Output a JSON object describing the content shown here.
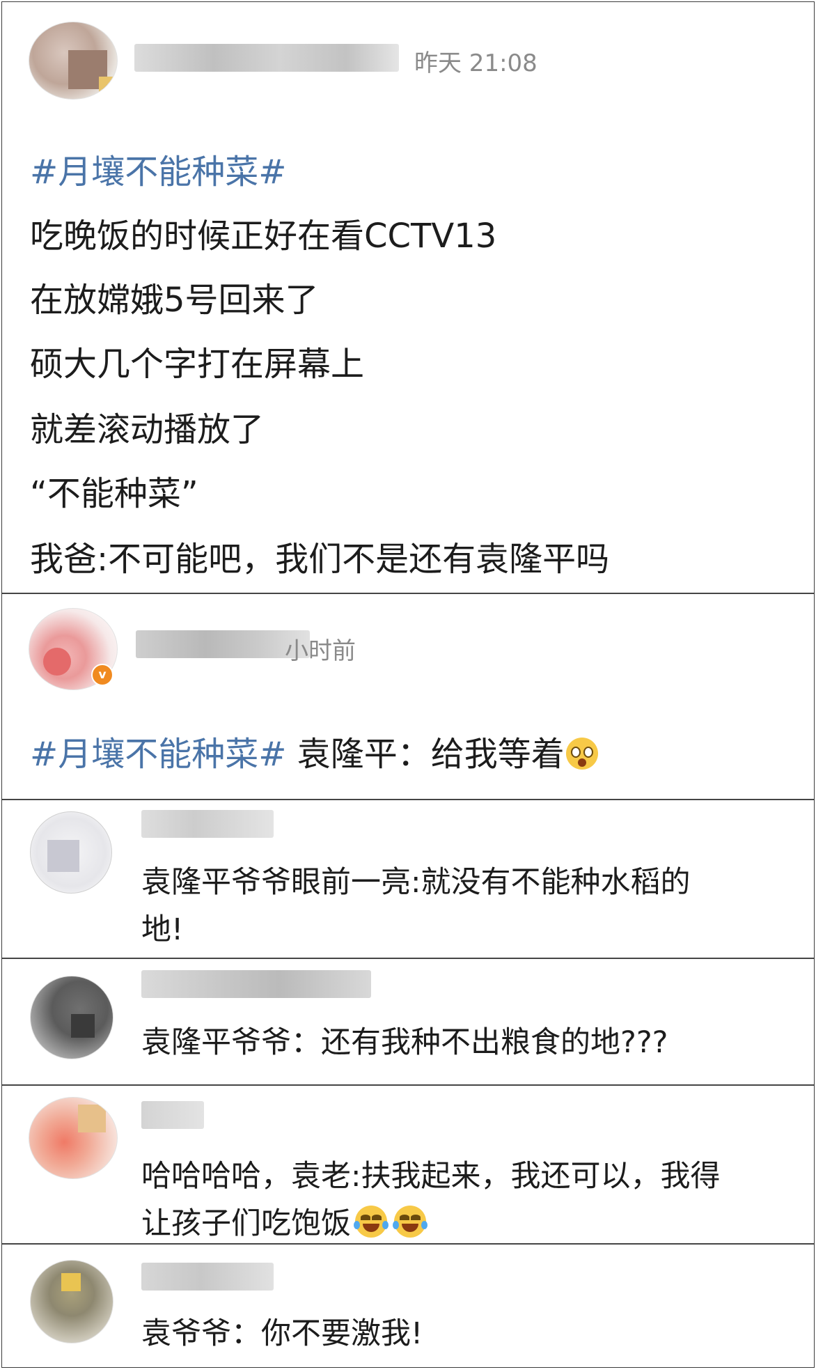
{
  "posts": [
    {
      "time": "昨天 21:08",
      "topic": "#月壤不能种菜#",
      "lines": [
        "吃晚饭的时候正好在看CCTV13",
        "在放嫦娥5号回来了",
        "硕大几个字打在屏幕上",
        "就差滚动播放了",
        "“不能种菜”",
        "我爸:不可能吧，我们不是还有袁隆平吗"
      ]
    },
    {
      "time": "小时前",
      "topic": "#月壤不能种菜#",
      "text": " 袁隆平：给我等着",
      "badge": "v"
    }
  ],
  "replies": [
    {
      "lines": [
        "袁隆平爷爷眼前一亮:就没有不能种水稻的",
        "地!"
      ]
    },
    {
      "lines": [
        "袁隆平爷爷：还有我种不出粮食的地???"
      ]
    },
    {
      "lines": [
        "哈哈哈哈，袁老:扶我起来，我还可以，我得",
        "让孩子们吃饱饭"
      ]
    },
    {
      "lines": [
        "袁爷爷：你不要激我!"
      ]
    }
  ],
  "icons": {
    "faint_emoji": "dizzy-face-icon",
    "laugh_emoji": "tears-of-joy-icon"
  },
  "colors": {
    "topic_link": "#4a74a8",
    "text": "#1c1c1c",
    "timestamp": "#8a8a8a",
    "divider": "#454545"
  }
}
